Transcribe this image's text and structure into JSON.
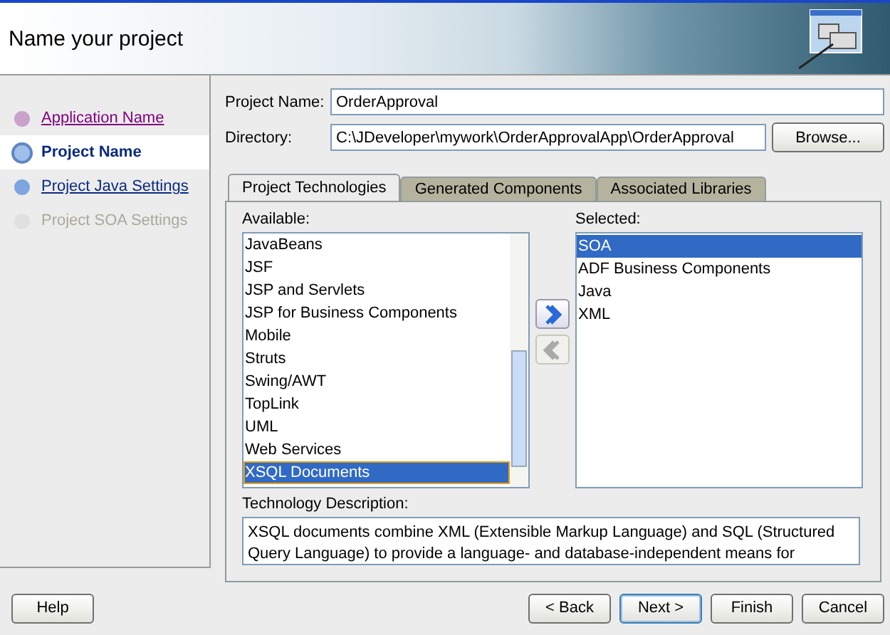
{
  "header": {
    "title": "Name your project"
  },
  "steps": [
    {
      "label": "Application Name",
      "kind": "visited",
      "selected": false
    },
    {
      "label": "Project Name",
      "kind": "current",
      "selected": true
    },
    {
      "label": "Project Java Settings",
      "kind": "link",
      "selected": false
    },
    {
      "label": "Project SOA Settings",
      "kind": "disabled",
      "selected": false
    }
  ],
  "fields": [
    {
      "label": "Project Name:",
      "value": "OrderApproval"
    },
    {
      "label": "Directory:",
      "value": "C:\\JDeveloper\\mywork\\OrderApprovalApp\\OrderApproval",
      "button": "Browse..."
    }
  ],
  "tabs": [
    {
      "label": "Project Technologies",
      "selected": true
    },
    {
      "label": "Generated Components",
      "selected": false
    },
    {
      "label": "Associated Libraries",
      "selected": false
    }
  ],
  "available": {
    "label": "Available:",
    "items": [
      {
        "text": "JavaBeans",
        "selected": false
      },
      {
        "text": "JSF",
        "selected": false
      },
      {
        "text": "JSP and Servlets",
        "selected": false
      },
      {
        "text": "JSP for Business Components",
        "selected": false
      },
      {
        "text": "Mobile",
        "selected": false
      },
      {
        "text": "Struts",
        "selected": false
      },
      {
        "text": "Swing/AWT",
        "selected": false
      },
      {
        "text": "TopLink",
        "selected": false
      },
      {
        "text": "UML",
        "selected": false
      },
      {
        "text": "Web Services",
        "selected": false
      },
      {
        "text": "XSQL Documents",
        "selected": true
      }
    ]
  },
  "move_buttons": [
    {
      "kind": "add",
      "disabled": false
    },
    {
      "kind": "remove",
      "disabled": true
    }
  ],
  "selected_list": {
    "label": "Selected:",
    "items": [
      {
        "text": "SOA",
        "selected": true
      },
      {
        "text": "ADF Business Components",
        "selected": false
      },
      {
        "text": "Java",
        "selected": false
      },
      {
        "text": "XML",
        "selected": false
      }
    ]
  },
  "description": {
    "label": "Technology Description:",
    "text": "XSQL documents combine XML (Extensible Markup Language) and SQL (Structured Query Language) to provide a language- and database-independent means for"
  },
  "buttons": [
    {
      "label": "Help",
      "kind": "help"
    },
    {
      "label": "< Back",
      "kind": "nav"
    },
    {
      "label": "Next >",
      "kind": "default"
    },
    {
      "label": "Finish",
      "kind": "nav"
    },
    {
      "label": "Cancel",
      "kind": "nav"
    }
  ]
}
